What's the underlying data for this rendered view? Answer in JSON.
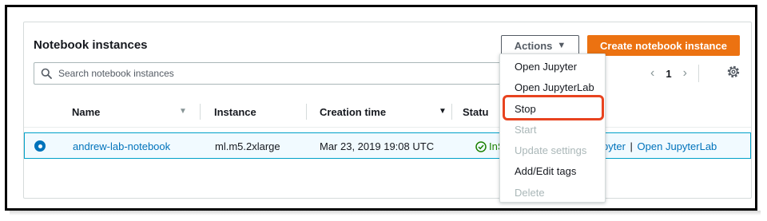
{
  "panel": {
    "title": "Notebook instances",
    "actions_label": "Actions",
    "create_label": "Create notebook instance"
  },
  "search": {
    "placeholder": "Search notebook instances"
  },
  "pagination": {
    "current_page": "1"
  },
  "table": {
    "columns": [
      "Name",
      "Instance",
      "Creation time",
      "Status"
    ],
    "columns_display": [
      "Name",
      "Instance",
      "Creation time",
      "Statu"
    ],
    "rows": [
      {
        "name": "andrew-lab-notebook",
        "instance": "ml.m5.2xlarge",
        "creation_time": "Mar 23, 2019 19:08 UTC",
        "status": "InS",
        "actions": [
          "Open Jupyter",
          "Open JupyterLab"
        ],
        "actions_visible": [
          "pyter",
          "Open JupyterLab"
        ],
        "action_separator": "|"
      }
    ]
  },
  "actions_menu": {
    "items": [
      {
        "label": "Open Jupyter",
        "enabled": true
      },
      {
        "label": "Open JupyterLab",
        "enabled": true
      },
      {
        "label": "Stop",
        "enabled": true,
        "highlighted": true
      },
      {
        "label": "Start",
        "enabled": false
      },
      {
        "label": "Update settings",
        "enabled": false
      },
      {
        "label": "Add/Edit tags",
        "enabled": true
      },
      {
        "label": "Delete",
        "enabled": false
      }
    ]
  },
  "icons": {
    "search": "search-icon",
    "actions_caret": "caret-down-icon",
    "prev": "chevron-left-icon",
    "next": "chevron-right-icon",
    "settings": "gear-icon",
    "sort": "caret-down-icon",
    "status": "check-circle-icon",
    "radio": "radio-selected-icon"
  },
  "colors": {
    "accent": "#ec7211",
    "link": "#0073bb",
    "success": "#1d8102",
    "selected_row_bg": "#f1faff",
    "selected_row_border": "#00a1c9",
    "highlight_border": "#e8431f"
  }
}
